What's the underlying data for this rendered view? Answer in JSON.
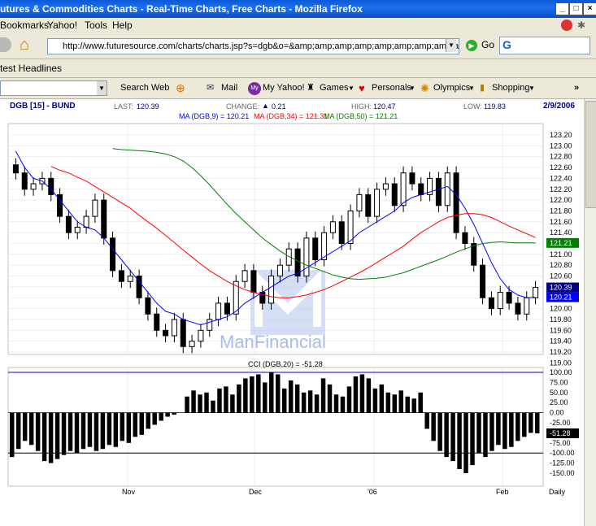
{
  "window": {
    "title": "utures & Commodities Charts - Real-Time Charts, Free Charts - Mozilla Firefox"
  },
  "menu": [
    "Bookmarks",
    "Yahoo!",
    "Tools",
    "Help"
  ],
  "nav": {
    "url": "http://www.futuresource.com/charts/charts.jsp?s=dgb&o=&amp;amp;amp;amp;amp;amp;amp;amp;amp;a=",
    "go_label": "Go",
    "search_letter": "G"
  },
  "headlines": {
    "label": "test Headlines"
  },
  "yahoo_toolbar": {
    "search_web": "Search Web",
    "mail": "Mail",
    "my_yahoo": "My Yahoo!",
    "games": "Games",
    "personals": "Personals",
    "olympics": "Olympics",
    "shopping": "Shopping"
  },
  "chart_header": {
    "symbol": "DGB [15] - BUND",
    "last_label": "LAST:",
    "last": "120.39",
    "change_label": "CHANGE:",
    "change": "0.21",
    "high_label": "HIGH:",
    "high": "120.47",
    "low_label": "LOW:",
    "low": "119.83",
    "date": "2/9/2006",
    "ma9": "MA (DGB,9) = 120.21",
    "ma34": "MA (DGB,34) = 121.31",
    "ma50": "MA (DGB,50) = 121.21",
    "cci_label": "CCI (DGB,20) = -51.28",
    "watermark": "ManFinancial"
  },
  "chart_data": [
    {
      "type": "candlestick",
      "title": "DGB [15] - BUND",
      "ylim": [
        119.2,
        123.2
      ],
      "y_ticks": [
        "123.20",
        "123.00",
        "122.80",
        "122.60",
        "122.40",
        "122.20",
        "122.00",
        "121.80",
        "121.60",
        "121.40",
        "121.20",
        "121.00",
        "120.80",
        "120.60",
        "120.40",
        "120.20",
        "120.00",
        "119.80",
        "119.60",
        "119.40",
        "119.20",
        "119.00"
      ],
      "x_ticks": [
        "Nov",
        "Dec",
        "'06",
        "Feb",
        "Daily"
      ],
      "closes": [
        122.5,
        122.2,
        122.3,
        122.4,
        122.1,
        121.7,
        121.4,
        121.5,
        121.7,
        122.0,
        121.3,
        120.7,
        120.5,
        120.6,
        120.2,
        119.9,
        119.6,
        119.5,
        119.8,
        119.3,
        119.4,
        119.6,
        119.8,
        120.1,
        119.9,
        120.5,
        120.7,
        120.3,
        120.1,
        120.6,
        120.8,
        121.1,
        120.6,
        121.3,
        120.9,
        121.4,
        121.6,
        121.2,
        121.8,
        122.1,
        121.7,
        122.2,
        122.3,
        121.9,
        122.5,
        122.3,
        122.1,
        122.4,
        121.9,
        122.5,
        121.4,
        121.2,
        120.8,
        120.2,
        120.0,
        120.3,
        120.1,
        119.9,
        120.2,
        120.39
      ],
      "series": [
        {
          "name": "MA (DGB,9)",
          "color": "#0000ff",
          "values": [
            122.9,
            122.6,
            122.4,
            122.35,
            122.2,
            122.0,
            121.8,
            121.6,
            121.5,
            121.45,
            121.3,
            121.1,
            120.9,
            120.7,
            120.5,
            120.3,
            120.1,
            119.95,
            119.9,
            119.8,
            119.75,
            119.7,
            119.75,
            119.8,
            119.85,
            119.95,
            120.1,
            120.2,
            120.3,
            120.4,
            120.5,
            120.6,
            120.65,
            120.75,
            120.85,
            120.95,
            121.05,
            121.15,
            121.25,
            121.4,
            121.5,
            121.6,
            121.7,
            121.8,
            121.95,
            122.05,
            122.1,
            122.15,
            122.2,
            122.25,
            122.1,
            121.85,
            121.55,
            121.2,
            120.85,
            120.55,
            120.35,
            120.25,
            120.2,
            120.21
          ]
        },
        {
          "name": "MA (DGB,34)",
          "color": "#ff0000",
          "values": [
            122.62,
            122.55,
            122.5,
            122.42,
            122.35,
            122.25,
            122.15,
            122.05,
            121.95,
            121.85,
            121.72,
            121.6,
            121.48,
            121.35,
            121.22,
            121.08,
            120.95,
            120.82,
            120.7,
            120.6,
            120.5,
            120.42,
            120.35,
            120.3,
            120.26,
            120.22,
            120.2,
            120.2,
            120.22,
            120.25,
            120.3,
            120.35,
            120.42,
            120.5,
            120.58,
            120.66,
            120.75,
            120.85,
            120.95,
            121.05,
            121.15,
            121.28,
            121.4,
            121.5,
            121.6,
            121.68,
            121.72,
            121.75,
            121.75,
            121.73,
            121.68,
            121.6,
            121.52,
            121.45,
            121.38,
            121.31
          ]
        },
        {
          "name": "MA (DGB,50)",
          "color": "#008000",
          "values": [
            122.95,
            122.93,
            122.92,
            122.91,
            122.9,
            122.88,
            122.85,
            122.8,
            122.72,
            122.6,
            122.45,
            122.28,
            122.1,
            121.92,
            121.75,
            121.6,
            121.45,
            121.3,
            121.18,
            121.06,
            120.96,
            120.88,
            120.8,
            120.74,
            120.68,
            120.62,
            120.58,
            120.55,
            120.54,
            120.55,
            120.56,
            120.58,
            120.62,
            120.66,
            120.72,
            120.78,
            120.84,
            120.9,
            120.97,
            121.04,
            121.1,
            121.16,
            121.2,
            121.22,
            121.23,
            121.22,
            121.21,
            121.21,
            121.21
          ]
        }
      ],
      "price_tags": [
        {
          "value": "121.21",
          "color": "#008000"
        },
        {
          "value": "120.39",
          "color": "#000080"
        },
        {
          "value": "120.21",
          "color": "#0000ff"
        }
      ]
    },
    {
      "type": "bar",
      "title": "CCI (DGB,20) = -51.28",
      "ylim": [
        -150,
        100
      ],
      "y_ticks": [
        "100.00",
        "75.00",
        "50.00",
        "25.00",
        "0.00",
        "-25.00",
        "-50.00",
        "-75.00",
        "-100.00",
        "-125.00",
        "-150.00"
      ],
      "reference_lines": [
        100,
        -100
      ],
      "last_label": "-51.28",
      "values": [
        -110,
        -90,
        -70,
        -80,
        -95,
        -120,
        -125,
        -115,
        -105,
        -95,
        -100,
        -90,
        -85,
        -95,
        -90,
        -80,
        -85,
        -70,
        -75,
        -60,
        -55,
        -40,
        -30,
        -20,
        -10,
        -5,
        0,
        40,
        55,
        45,
        50,
        30,
        60,
        65,
        45,
        70,
        85,
        90,
        95,
        75,
        100,
        95,
        60,
        80,
        70,
        50,
        55,
        45,
        85,
        70,
        45,
        40,
        65,
        90,
        95,
        85,
        60,
        70,
        50,
        45,
        55,
        40,
        35,
        50,
        -40,
        -70,
        -95,
        -110,
        -120,
        -140,
        -150,
        -130,
        -100,
        -110,
        -95,
        -80,
        -90,
        -85,
        -70,
        -60,
        -50,
        -51.28
      ]
    }
  ]
}
